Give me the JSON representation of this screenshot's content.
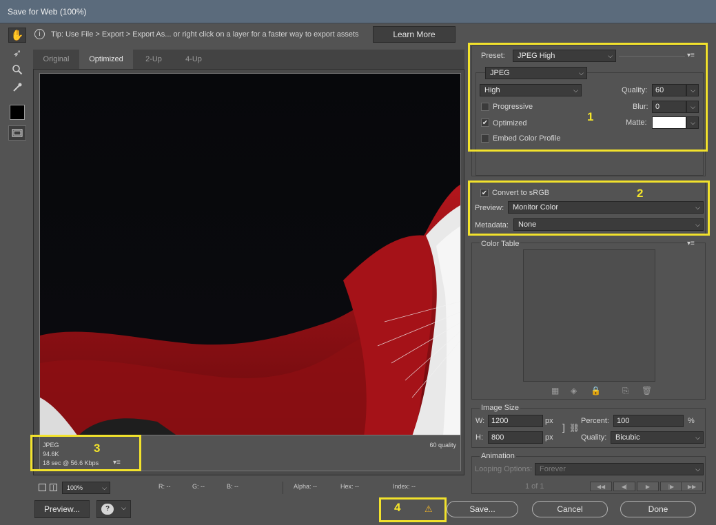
{
  "window": {
    "title": "Save for Web (100%)"
  },
  "tip": {
    "text": "Tip: Use File > Export > Export As...  or right click on a layer for a faster way to export assets",
    "learn_more": "Learn More"
  },
  "tools": [
    {
      "name": "hand-tool",
      "glyph": "✋"
    },
    {
      "name": "slice-select-tool",
      "glyph": "⬈"
    },
    {
      "name": "zoom-tool",
      "glyph": "🔍"
    },
    {
      "name": "eyedropper-tool",
      "glyph": "✎"
    }
  ],
  "tabs": [
    "Original",
    "Optimized",
    "2-Up",
    "4-Up"
  ],
  "active_tab": "Optimized",
  "image_info": {
    "format": "JPEG",
    "size": "94.6K",
    "download": "18 sec @ 56.6 Kbps",
    "quality_note": "60 quality"
  },
  "preset": {
    "label": "Preset:",
    "value": "JPEG High",
    "format": "JPEG",
    "compression": "High",
    "quality_label": "Quality:",
    "quality": "60",
    "blur_label": "Blur:",
    "blur": "0",
    "matte_label": "Matte:",
    "matte_color": "#ffffff",
    "progressive": {
      "label": "Progressive",
      "checked": false
    },
    "optimized": {
      "label": "Optimized",
      "checked": true
    },
    "embed_profile": {
      "label": "Embed Color Profile",
      "checked": false
    }
  },
  "color_settings": {
    "convert_srgb": {
      "label": "Convert to sRGB",
      "checked": true
    },
    "preview_label": "Preview:",
    "preview_value": "Monitor Color",
    "metadata_label": "Metadata:",
    "metadata_value": "None"
  },
  "color_table": {
    "title": "Color Table"
  },
  "image_size": {
    "title": "Image Size",
    "w_label": "W:",
    "w": "1200",
    "h_label": "H:",
    "h": "800",
    "unit": "px",
    "percent_label": "Percent:",
    "percent": "100",
    "percent_unit": "%",
    "quality_label": "Quality:",
    "quality_value": "Bicubic"
  },
  "animation": {
    "title": "Animation",
    "looping_label": "Looping Options:",
    "looping_value": "Forever",
    "frame": "1 of 1"
  },
  "zoom": "100%",
  "readouts": {
    "r": "R: --",
    "g": "G: --",
    "b": "B: --",
    "alpha": "Alpha: --",
    "hex": "Hex: --",
    "index": "Index: --"
  },
  "buttons": {
    "preview": "Preview...",
    "save": "Save...",
    "cancel": "Cancel",
    "done": "Done"
  },
  "annotations": [
    "1",
    "2",
    "3",
    "4"
  ],
  "highlight_color": "#f2e22c"
}
